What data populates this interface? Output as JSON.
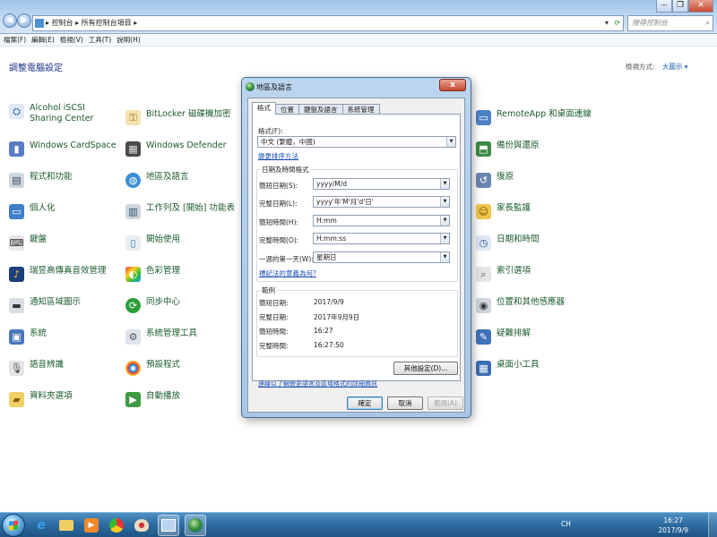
{
  "explorer": {
    "address": [
      "控制台",
      "所有控制台項目"
    ],
    "search_placeholder": "搜尋控制台",
    "menu": [
      "檔案(F)",
      "編輯(E)",
      "檢視(V)",
      "工具(T)",
      "說明(H)"
    ],
    "page_title": "調整電腦設定",
    "view_by_label": "檢視方式:",
    "view_by_value": "大圖示 ▾"
  },
  "items": {
    "col1": [
      "Alcohol iSCSI Sharing Center",
      "Windows CardSpace",
      "程式和功能",
      "個人化",
      "鍵盤",
      "瑞昱高傳真音效管理",
      "通知區域圖示",
      "系統",
      "語音辨識",
      "資料夾選項"
    ],
    "col2": [
      "BitLocker 磁碟機加密",
      "Windows Defender",
      "地區及語言",
      "工作列及 [開始] 功能表",
      "開始使用",
      "色彩管理",
      "同步中心",
      "系統管理工具",
      "預設程式",
      "自動播放"
    ],
    "col4": [
      "RemoteApp 和桌面連線",
      "備份與還原",
      "復原",
      "家長監護",
      "日期和時間",
      "索引選項",
      "位置和其他感應器",
      "疑難排解",
      "桌面小工具"
    ]
  },
  "dialog": {
    "title": "地區及語言",
    "close": "x",
    "tabs": [
      "格式",
      "位置",
      "鍵盤及語言",
      "系統管理"
    ],
    "format_label": "格式(F):",
    "format_value": "中文 (繁體，中國)",
    "change_sort_link": "變更排序方法",
    "datetime_group": "日期及時間格式",
    "fields": [
      {
        "label": "簡短日期(S):",
        "value": "yyyy/M/d"
      },
      {
        "label": "完整日期(L):",
        "value": "yyyy'年'M'月'd'日'"
      },
      {
        "label": "簡短時間(H):",
        "value": "H:mm"
      },
      {
        "label": "完整時間(O):",
        "value": "H:mm:ss"
      },
      {
        "label": "一週的第一天(W):",
        "value": "星期日"
      }
    ],
    "notation_link": "標記法的意義為何?",
    "examples_group": "範例",
    "examples": [
      {
        "label": "簡短日期:",
        "value": "2017/9/9"
      },
      {
        "label": "完整日期:",
        "value": "2017年9月9日"
      },
      {
        "label": "簡短時間:",
        "value": "16:27"
      },
      {
        "label": "完整時間:",
        "value": "16:27:50"
      }
    ],
    "other_settings": "其他設定(D)...",
    "online_link": "連線以了解變更語言及區域格式的詳細資訊",
    "ok": "確定",
    "cancel": "取消",
    "apply": "套用(A)"
  },
  "taskbar": {
    "ime": "CH",
    "time": "16:27",
    "date": "2017/9/9"
  }
}
